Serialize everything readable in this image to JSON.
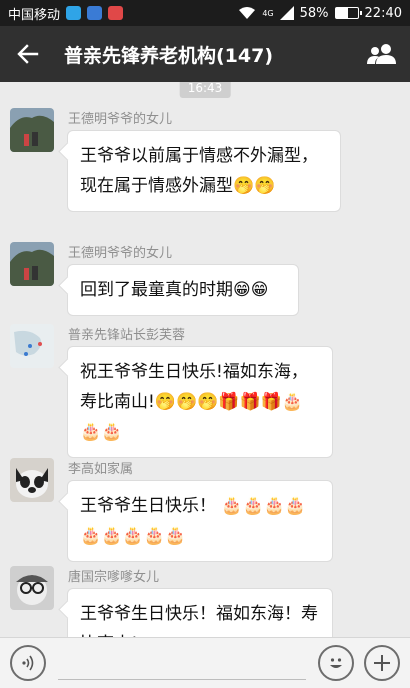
{
  "status_bar": {
    "carrier": "中国移动",
    "network": "4G",
    "battery": "58%",
    "battery_level": 0.58,
    "time": "22:40",
    "icons": [
      "message-icon",
      "photo-icon",
      "app-icon",
      "wifi-icon",
      "signal-icon",
      "battery-icon"
    ]
  },
  "header": {
    "title": "普亲先锋养老机构(147)",
    "back_icon": "arrow-left-icon",
    "group_icon": "group-members-icon"
  },
  "chat": {
    "timestamp": "16:43",
    "messages": [
      {
        "sender": "王德明爷爷的女儿",
        "text": "王爷爷以前属于情感不外漏型，现在属于情感外漏型🤭🤭"
      },
      {
        "sender": "王德明爷爷的女儿",
        "text": "回到了最童真的时期😁😁"
      },
      {
        "sender": "普亲先锋站长彭芙蓉",
        "text": "祝王爷爷生日快乐!福如东海，寿比南山!🤭🤭🤭🎁🎁🎁🎂🎂🎂"
      },
      {
        "sender": "李高如家属",
        "text": "王爷爷生日快乐！ 🎂🎂🎂🎂🎂🎂🎂🎂🎂"
      },
      {
        "sender": "唐国宗嗲嗲女儿",
        "text": "王爷爷生日快乐！福如东海！寿比南山!"
      }
    ]
  },
  "input_bar": {
    "voice_icon": "voice-icon",
    "emoji_icon": "emoji-icon",
    "add_icon": "plus-icon"
  },
  "colors": {
    "title_bar": "#303030",
    "status_bar": "#1c1c1c",
    "chat_bg": "#ebebeb",
    "bubble": "#ffffff",
    "sender_text": "#8f8f8f"
  }
}
